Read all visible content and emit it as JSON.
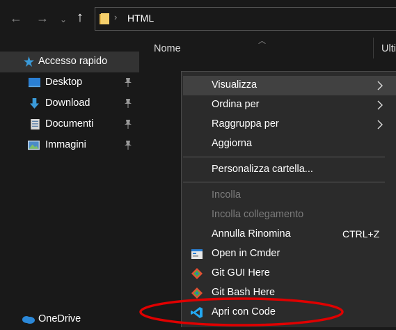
{
  "toolbar": {
    "back_icon": "back-arrow-icon",
    "forward_icon": "forward-arrow-icon",
    "recent_icon": "chevron-down-icon",
    "up_icon": "up-arrow-icon",
    "address": {
      "path": "HTML"
    }
  },
  "sidebar": {
    "items": [
      {
        "label": "Accesso rapido",
        "icon": "star-icon",
        "selected": true
      },
      {
        "label": "Desktop",
        "icon": "desktop-icon",
        "pinned": true
      },
      {
        "label": "Download",
        "icon": "download-icon",
        "pinned": true
      },
      {
        "label": "Documenti",
        "icon": "documents-icon",
        "pinned": true
      },
      {
        "label": "Immagini",
        "icon": "pictures-icon",
        "pinned": true
      },
      {
        "label": "OneDrive",
        "icon": "onedrive-icon"
      }
    ]
  },
  "content": {
    "columns": [
      "Nome",
      "Ulti"
    ]
  },
  "context_menu": {
    "items": [
      {
        "label": "Visualizza",
        "submenu": true,
        "highlighted": true
      },
      {
        "label": "Ordina per",
        "submenu": true
      },
      {
        "label": "Raggruppa per",
        "submenu": true
      },
      {
        "label": "Aggiorna"
      },
      {
        "label": "Personalizza cartella..."
      },
      {
        "label": "Incolla",
        "disabled": true
      },
      {
        "label": "Incolla collegamento",
        "disabled": true
      },
      {
        "label": "Annulla Rinomina",
        "shortcut": "CTRL+Z"
      },
      {
        "label": "Open in Cmder",
        "icon": "cmder-icon"
      },
      {
        "label": "Git GUI Here",
        "icon": "git-icon"
      },
      {
        "label": "Git Bash Here",
        "icon": "git-icon"
      },
      {
        "label": "Apri con Code",
        "icon": "vscode-icon"
      }
    ]
  },
  "colors": {
    "background": "#191919",
    "menu_background": "#2b2b2b",
    "highlight": "#414141",
    "annotation_circle": "#e00000",
    "accent_blue": "#3a9ad9"
  }
}
